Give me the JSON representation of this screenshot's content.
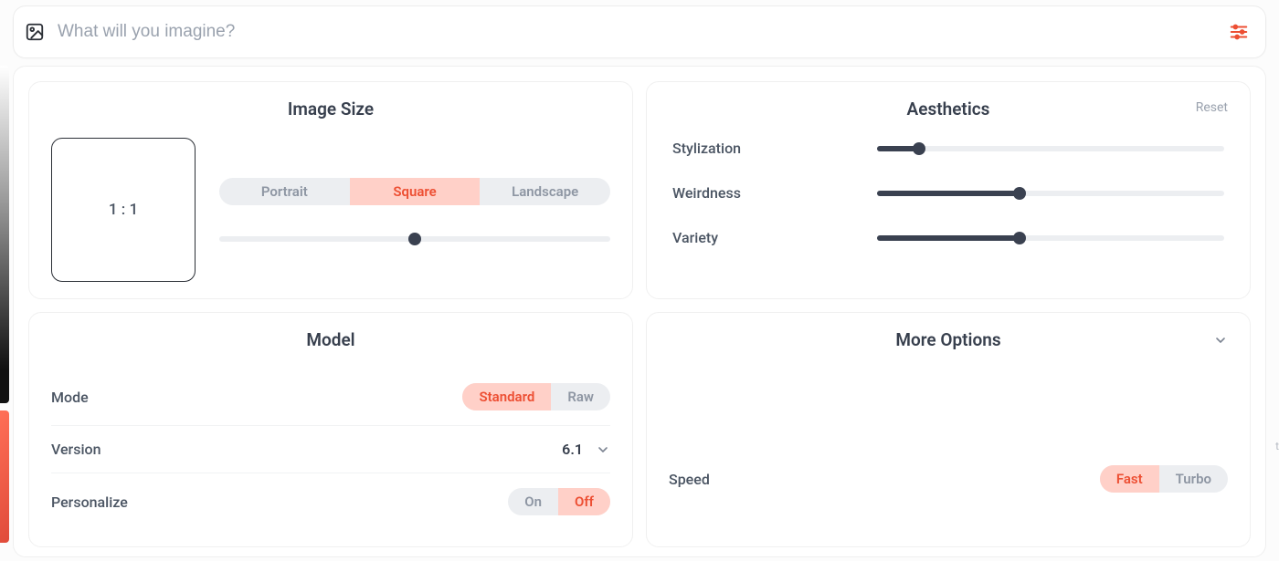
{
  "topbar": {
    "placeholder": "What will you imagine?"
  },
  "image_size": {
    "title": "Image Size",
    "ratio_label": "1 : 1",
    "tabs": {
      "portrait": "Portrait",
      "square": "Square",
      "landscape": "Landscape"
    },
    "slider_percent": 50
  },
  "aesthetics": {
    "title": "Aesthetics",
    "reset": "Reset",
    "rows": {
      "stylization": {
        "label": "Stylization",
        "percent": 12
      },
      "weirdness": {
        "label": "Weirdness",
        "percent": 41
      },
      "variety": {
        "label": "Variety",
        "percent": 41
      }
    }
  },
  "model": {
    "title": "Model",
    "mode_label": "Mode",
    "mode_options": {
      "standard": "Standard",
      "raw": "Raw"
    },
    "version_label": "Version",
    "version_value": "6.1",
    "personalize_label": "Personalize",
    "personalize_options": {
      "on": "On",
      "off": "Off"
    }
  },
  "more": {
    "title": "More Options",
    "speed_label": "Speed",
    "speed_options": {
      "fast": "Fast",
      "turbo": "Turbo"
    }
  },
  "colors": {
    "accent": "#ed4f33",
    "accent_bg": "#ffd0c8",
    "knob": "#3a4150"
  }
}
